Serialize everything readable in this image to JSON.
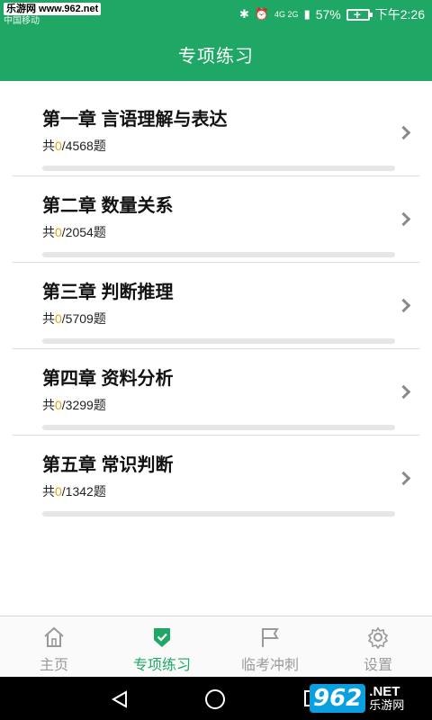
{
  "status_bar": {
    "watermark": "乐游网 www.962.net",
    "carrier": "中国移动",
    "network": "4G 2G",
    "battery": "57%",
    "time": "下午2:26"
  },
  "header": {
    "title": "专项练习"
  },
  "chapters": [
    {
      "title": "第一章 言语理解与表达",
      "prefix": "共",
      "done": "0",
      "total": "/4568题",
      "progress": 0
    },
    {
      "title": "第二章 数量关系",
      "prefix": "共",
      "done": "0",
      "total": "/2054题",
      "progress": 0
    },
    {
      "title": "第三章 判断推理",
      "prefix": "共",
      "done": "0",
      "total": "/5709题",
      "progress": 0
    },
    {
      "title": "第四章 资料分析",
      "prefix": "共",
      "done": "0",
      "total": "/3299题",
      "progress": 0
    },
    {
      "title": "第五章 常识判断",
      "prefix": "共",
      "done": "0",
      "total": "/1342题",
      "progress": 0
    }
  ],
  "tabs": [
    {
      "label": "主页",
      "icon": "home-icon",
      "active": false
    },
    {
      "label": "专项练习",
      "icon": "shield-check-icon",
      "active": true
    },
    {
      "label": "临考冲刺",
      "icon": "flag-icon",
      "active": false
    },
    {
      "label": "设置",
      "icon": "gear-icon",
      "active": false
    }
  ],
  "brand": {
    "logo_number": "962",
    "logo_net": ".NET",
    "logo_cn": "乐游网"
  },
  "colors": {
    "primary": "#1ea765",
    "accent_count": "#e0a31a",
    "inactive": "#9a9a9a"
  }
}
